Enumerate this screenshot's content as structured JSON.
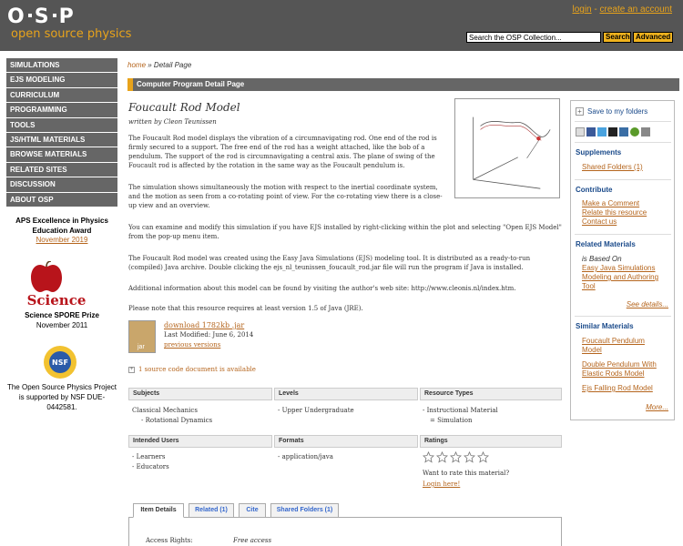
{
  "header": {
    "logo_text": "O S P",
    "logo_sub": "open source physics",
    "login": "login",
    "separator": " - ",
    "create_account": "create an account",
    "search_value": "Search the OSP Collection...",
    "search_button": "Search",
    "advanced_button": "Advanced"
  },
  "sidebar": {
    "items": [
      {
        "label": "SIMULATIONS"
      },
      {
        "label": "EJS MODELING"
      },
      {
        "label": "CURRICULUM"
      },
      {
        "label": "PROGRAMMING"
      },
      {
        "label": "TOOLS"
      },
      {
        "label": "JS/HTML MATERIALS"
      },
      {
        "label": "BROWSE MATERIALS"
      },
      {
        "label": "RELATED SITES"
      },
      {
        "label": "DISCUSSION"
      },
      {
        "label": "ABOUT OSP"
      }
    ],
    "aps_title": "APS Excellence in Physics Education Award",
    "aps_date": "November 2019",
    "science_logo_text": "Science",
    "spore_title": "Science SPORE Prize",
    "spore_date": "November 2011",
    "nsf_logo_text": "NSF",
    "nsf_text": "The Open Source Physics Project is supported by NSF DUE-0442581."
  },
  "breadcrumb": {
    "home": "home",
    "separator": " » ",
    "current": "Detail Page"
  },
  "section_bar": "Computer Program Detail Page",
  "resource": {
    "title": "Foucault Rod Model",
    "author": "written by Cleon Teunissen",
    "p1": "The Foucault Rod model displays the vibration of a circumnavigating rod. One end of the rod is firmly secured to a support. The free end of the rod has a weight attached, like the bob of a pendulum. The support of the rod is circumnavigating a central axis. The plane of swing of the Foucault rod is affected by the rotation in the same way as the Foucault pendulum is.",
    "p2": "The simulation shows simultaneously the motion with respect to the inertial coordinate system, and the motion as seen from a co-rotating point of view.  For the co-rotating view there is a close-up view and an overview.",
    "p3": "You can examine and modify this simulation if you have EJS installed by right-clicking within the plot and selecting \"Open EJS Model\" from the pop-up menu item.",
    "p4": "The  Foucault Rod model was created using the Easy Java Simulations (EJS) modeling tool.  It is distributed as a ready-to-run (compiled) Java archive.  Double clicking the ejs_nl_teunissen_foucault_rod.jar file will run the program if Java is installed.",
    "p5": "Additional information about this model can be found by visiting the author's web site: http://www.cleonis.nl/index.htm.",
    "p6": "Please note that this resource requires at least version 1.5 of Java (JRE).",
    "jar_label": "jar",
    "download": "download 1782kb .jar",
    "last_modified": "Last Modified: June 6, 2014",
    "previous_versions": "previous versions",
    "source_plus": "+",
    "source_doc": "1 source code document is available"
  },
  "table": {
    "subjects_head": "Subjects",
    "subjects": [
      "Classical Mechanics",
      "- Rotational Dynamics"
    ],
    "levels_head": "Levels",
    "levels": [
      "- Upper Undergraduate"
    ],
    "types_head": "Resource Types",
    "types": [
      "- Instructional Material",
      "= Simulation"
    ],
    "users_head": "Intended Users",
    "users": [
      "- Learners",
      "- Educators"
    ],
    "formats_head": "Formats",
    "formats": [
      "- application/java"
    ],
    "ratings_head": "Ratings",
    "rating_stars": 0,
    "rate_text": "Want to rate this material?",
    "login_here": "Login here!"
  },
  "tabs": [
    {
      "label": "Item Details"
    },
    {
      "label": "Related (1)"
    },
    {
      "label": "Cite"
    },
    {
      "label": "Shared Folders (1)"
    }
  ],
  "details": {
    "access_label": "Access Rights:",
    "access_value": "Free access"
  },
  "right_panel": {
    "save_box": "+",
    "save": "Save to my folders",
    "supplements_head": "Supplements",
    "shared_folders": "Shared Folders (1)",
    "contribute_head": "Contribute",
    "make_comment": "Make a Comment",
    "relate": "Relate this resource",
    "contact": "Contact us",
    "related_head": "Related Materials",
    "is_based_on": "is Based On",
    "ejs_sims": "Easy Java Simulations Modeling and Authoring Tool",
    "see_details": "See details...",
    "similar_head": "Similar Materials",
    "similar": [
      "Foucault Pendulum Model",
      "Double Pendulum With Elastic Rods Model",
      "Ejs Falling Rod Model"
    ],
    "more": "More..."
  },
  "colors": {
    "header_bg": "#555555",
    "accent": "#e8a31b",
    "nav_bg": "#666666",
    "link": "#b5651d",
    "panel_head": "#1a4a8a"
  }
}
